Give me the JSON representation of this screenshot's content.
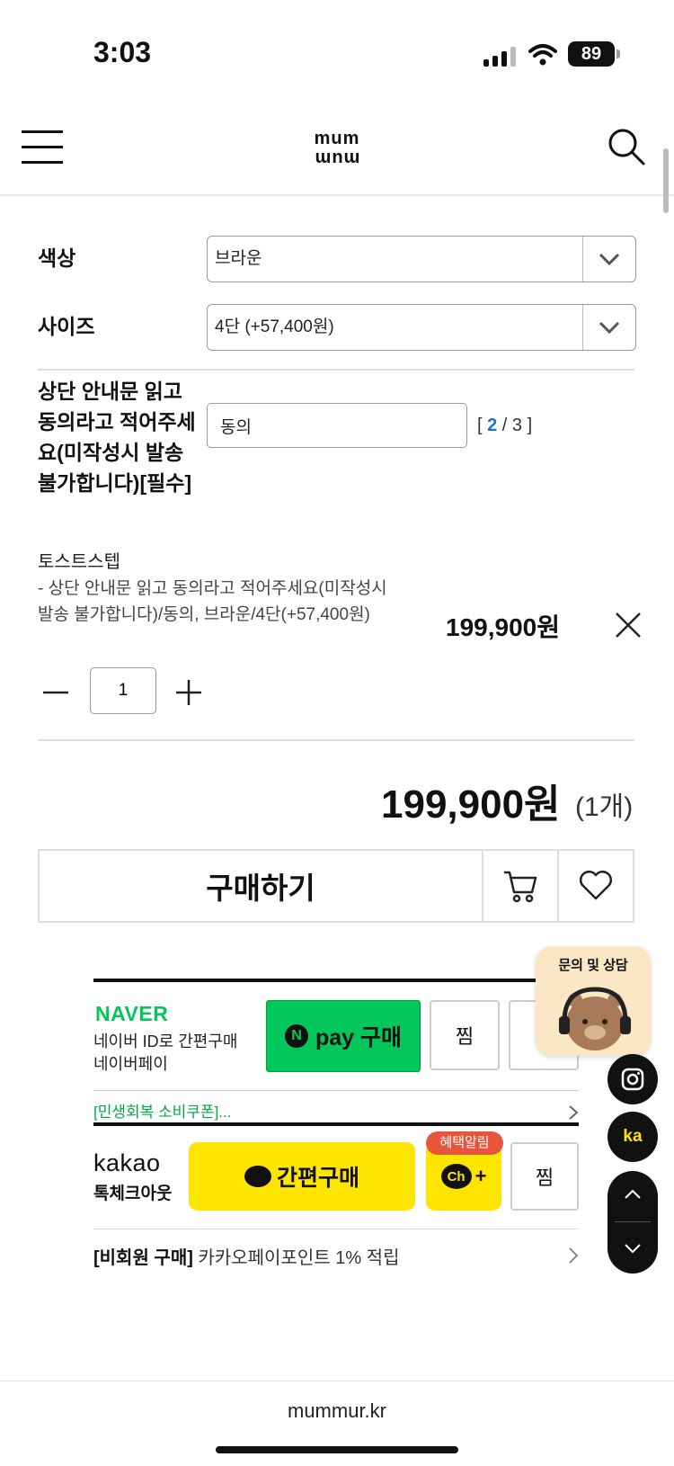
{
  "status_bar": {
    "time": "3:03",
    "battery": "89"
  },
  "header": {
    "logo_top": "mum",
    "logo_bottom": "mum"
  },
  "options": {
    "color_label": "색상",
    "color_value": "브라운",
    "size_label": "사이즈",
    "size_value": "4단 (+57,400원)",
    "agree_label": "상단 안내문 읽고 동의라고 적어주세요(미작성시 발송 불가합니다)[필수]",
    "agree_value": "동의",
    "agree_counter_current": "2",
    "agree_counter_total": "3"
  },
  "selected_product": {
    "name": "토스트스텝",
    "option": "- 상단 안내문 읽고 동의라고 적어주세요(미작성시 발송 불가합니다)/동의, 브라운/4단(+57,400원)",
    "price": "199,900원",
    "quantity": "1"
  },
  "total": {
    "price": "199,900원",
    "count": "(1개)"
  },
  "actions": {
    "buy_label": "구매하기"
  },
  "naver": {
    "logo": "NAVER",
    "desc_line1": "네이버 ID로 간편구매",
    "desc_line2": "네이버페이",
    "npay_label": "pay 구매",
    "npay_mark": "N",
    "wish_label": "찜",
    "coupon": "[민생회복 소비쿠폰]..."
  },
  "kakao": {
    "logo": "kakao",
    "sub": "톡체크아웃",
    "buy_label": "간편구매",
    "benefit_badge": "혜택알림",
    "ch_label": "Ch",
    "wish_label": "찜",
    "nonmember_bold": "[비회원 구매]",
    "nonmember_text": " 카카오페이포인트 1% 적립"
  },
  "floating": {
    "consult_label": "문의 및 상담",
    "kakao_fab": "ka"
  },
  "footer": {
    "url": "mummur.kr"
  },
  "colors": {
    "naver_green": "#03c75a",
    "kakao_yellow": "#fee500",
    "counter_blue": "#1c6fd1",
    "benefit_red": "#e8553d"
  }
}
